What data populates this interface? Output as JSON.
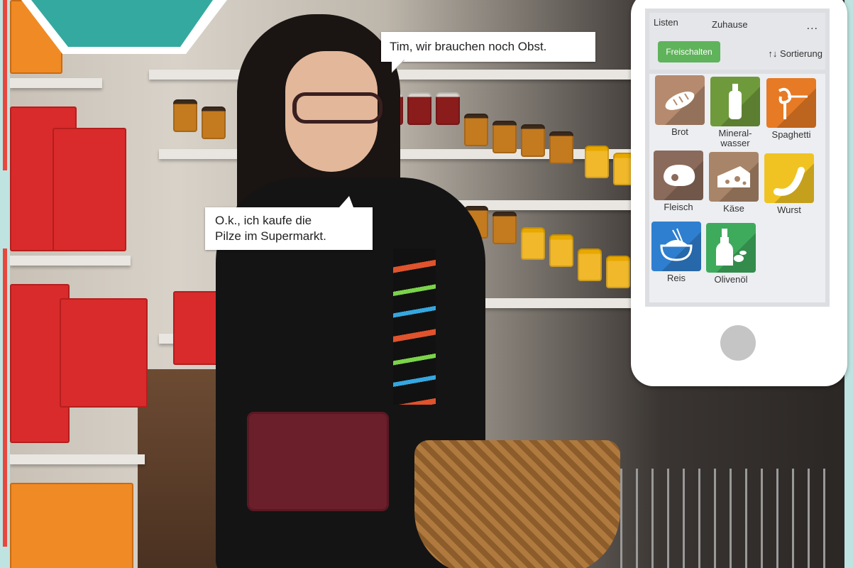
{
  "speech": {
    "tim": "Tim, wir brauchen noch Obst.",
    "reply_line1": "O.k., ich kaufe die",
    "reply_line2": "Pilze im Supermarkt."
  },
  "phone": {
    "tabs": [
      "Listen",
      "Zuhause"
    ],
    "menu": "...",
    "unlock_label": "Freischalten",
    "sort_label": "↑↓ Sortierung",
    "items": [
      {
        "label": "Brot",
        "color": "#b58a6e",
        "icon": "bread-icon"
      },
      {
        "label": "Mineral-\nwasser",
        "color": "#6f9a3b",
        "icon": "bottle-icon"
      },
      {
        "label": "Spaghetti",
        "color": "#e67a25",
        "icon": "spaghetti-icon"
      },
      {
        "label": "Fleisch",
        "color": "#8a6a5a",
        "icon": "meat-icon"
      },
      {
        "label": "Käse",
        "color": "#a88468",
        "icon": "cheese-icon"
      },
      {
        "label": "Wurst",
        "color": "#f0c322",
        "icon": "sausage-icon"
      },
      {
        "label": "Reis",
        "color": "#2f7fd0",
        "icon": "rice-bowl-icon"
      },
      {
        "label": "Olivenöl",
        "color": "#3eab5c",
        "icon": "olive-oil-icon"
      }
    ]
  },
  "colors": {
    "teal": "#34a9a0",
    "background": "#bfe3e0"
  }
}
